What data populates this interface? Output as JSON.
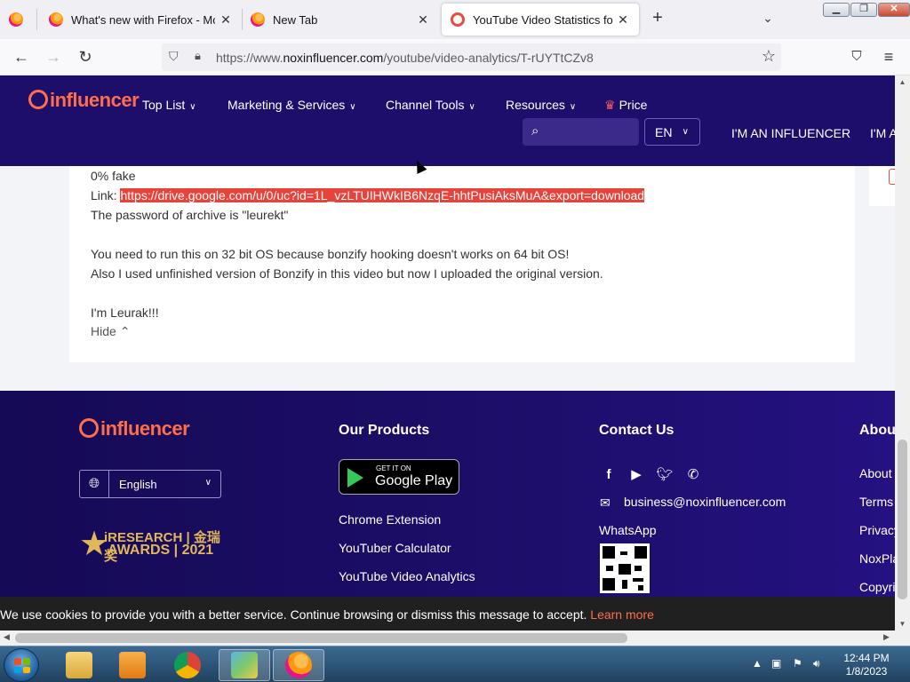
{
  "browser": {
    "tabs": [
      {
        "title": "What's new with Firefox - More"
      },
      {
        "title": "New Tab"
      },
      {
        "title": "YouTube Video Statistics for Bo"
      }
    ],
    "url": {
      "prefix": "https://www.",
      "domain": "noxinfluencer.com",
      "path": "/youtube/video-analytics/T-rUYTtCZv8"
    }
  },
  "site": {
    "logo_text": "influencer",
    "menu": [
      {
        "label": "Top List"
      },
      {
        "label": "Marketing & Services"
      },
      {
        "label": "Channel Tools"
      },
      {
        "label": "Resources"
      },
      {
        "label": "Price"
      }
    ],
    "search_placeholder": "",
    "language": "EN",
    "influencer_link": "I'M AN INFLUENCER",
    "advertiser_link": "I'M A"
  },
  "description": {
    "lines": [
      "0% fake",
      "Link: ",
      "The password of archive is \"leurekt\"",
      "",
      "You need to run this on 32 bit OS because bonzify hooking doesn't works on 64 bit OS!",
      "Also I used unfinished version of Bonzify in this video but now I uploaded the original version.",
      "",
      "I'm Leurak!!!"
    ],
    "link_url": "https://drive.google.com/u/0/uc?id=1L_vzLTUIHWkIB6NzqE-hhtPusiAksMuA&export=download",
    "hide_label": "Hide"
  },
  "footer": {
    "logo_text": "influencer",
    "language_select": "English",
    "awards": {
      "line1": "iRESEARCH | 金瑞奖",
      "line2": "AWARDS | 2021"
    },
    "products": {
      "heading": "Our Products",
      "gplay_small": "GET IT ON",
      "gplay_big": "Google Play",
      "links": [
        "Chrome Extension",
        "YouTuber Calculator",
        "YouTube Video Analytics"
      ]
    },
    "contact": {
      "heading": "Contact Us",
      "email": "business@noxinfluencer.com",
      "whatsapp": "WhatsApp"
    },
    "about": {
      "heading": "About",
      "links": [
        "About",
        "Terms",
        "Privacy",
        "NoxPla",
        "Copyri"
      ]
    }
  },
  "cookie": {
    "text": "We use cookies to provide you with a better service. Continue browsing or dismiss this message to accept. ",
    "learn_more": "Learn more"
  },
  "taskbar": {
    "time": "12:44 PM",
    "date": "1/8/2023"
  },
  "colors": {
    "header_bg": "#1d0e6b",
    "brand_orange": "#ff6e4a",
    "link_highlight": "#e8433a"
  }
}
